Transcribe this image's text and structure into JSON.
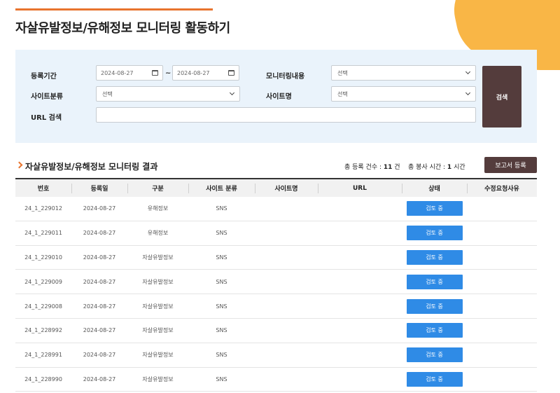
{
  "page": {
    "title": "자살유발정보/유해정보 모니터링 활동하기"
  },
  "filters": {
    "reg_period_label": "등록기간",
    "date_from": "2024-08-27",
    "date_to": "2024-08-27",
    "tilde": "~",
    "content_label": "모니터링내용",
    "content_value": "선택",
    "site_cat_label": "사이트분류",
    "site_cat_value": "선택",
    "site_name_label": "사이트명",
    "site_name_value": "선택",
    "url_label": "URL 검색",
    "url_value": "",
    "search_label": "검색"
  },
  "results": {
    "title": "자살유발정보/유해정보 모니터링 결과",
    "total_label": "총 등록 건수 :",
    "total_value": "11",
    "total_unit": "건",
    "hours_label": "총 봉사 시간 :",
    "hours_value": "1",
    "hours_unit": "시간",
    "report_label": "보고서 등록",
    "columns": [
      "번호",
      "등록일",
      "구분",
      "사이트 분류",
      "사이트명",
      "URL",
      "상태",
      "수정요청사유"
    ],
    "rows": [
      {
        "no": "24_1_229012",
        "date": "2024-08-27",
        "type": "유해정보",
        "site_cat": "SNS",
        "status": "검토 중"
      },
      {
        "no": "24_1_229011",
        "date": "2024-08-27",
        "type": "유해정보",
        "site_cat": "SNS",
        "status": "검토 중"
      },
      {
        "no": "24_1_229010",
        "date": "2024-08-27",
        "type": "자살유발정보",
        "site_cat": "SNS",
        "status": "검토 중"
      },
      {
        "no": "24_1_229009",
        "date": "2024-08-27",
        "type": "자살유발정보",
        "site_cat": "SNS",
        "status": "검토 중"
      },
      {
        "no": "24_1_229008",
        "date": "2024-08-27",
        "type": "자살유발정보",
        "site_cat": "SNS",
        "status": "검토 중"
      },
      {
        "no": "24_1_228992",
        "date": "2024-08-27",
        "type": "자살유발정보",
        "site_cat": "SNS",
        "status": "검토 중"
      },
      {
        "no": "24_1_228991",
        "date": "2024-08-27",
        "type": "자살유발정보",
        "site_cat": "SNS",
        "status": "검토 중"
      },
      {
        "no": "24_1_228990",
        "date": "2024-08-27",
        "type": "자살유발정보",
        "site_cat": "SNS",
        "status": "검토 중"
      }
    ]
  },
  "colors": {
    "accent": "#e8742e",
    "brown": "#543c3c",
    "blue": "#2f8be6",
    "filter_bg": "#eaf3fb",
    "deco": "#f9b646"
  }
}
